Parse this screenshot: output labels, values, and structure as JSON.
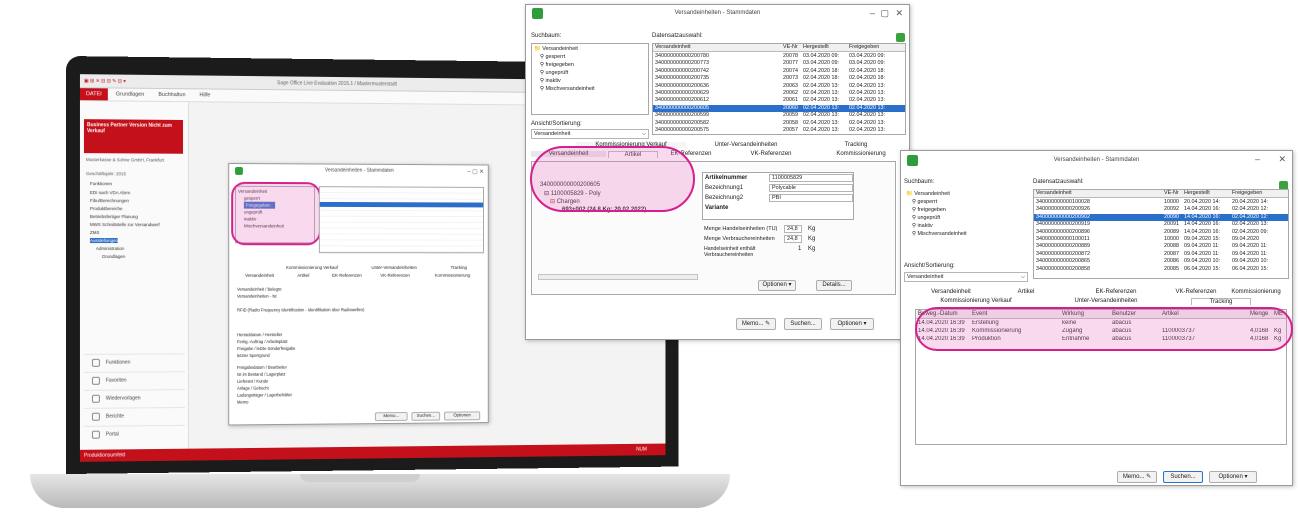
{
  "laptop": {
    "title": "Sage Office Line Evaluation 2015.1 / Mastermusterstadt",
    "menu": [
      "DATEI",
      "Grundlagen",
      "Buchhaltun",
      "Hilfe"
    ],
    "promo": "Business Partner Version Nicht zum Verkauf",
    "company": "Musterkasse & Sohne GmbH, Frankfurt",
    "fiscal": "Geschäftsjahr: 2015",
    "tree": [
      "Funktionen",
      "EDI nach VDA Abrm",
      "Fibu/Berechnungen",
      "Produktbereiche",
      "Betriebsfertiger Planung",
      "MWS Schnittstelle zur Versandwerf",
      "ZMS",
      "Ausstellungen",
      "Administration",
      "Grundlagen"
    ],
    "side_buttons": [
      "Funktionen",
      "Favoriten",
      "Wiedervorlagen",
      "Berichte",
      "Portal"
    ],
    "status_left": "Produktionsumfeld",
    "status_right": "NUM",
    "inner_title": "Versandeinheiten - Stammdaten",
    "inner_tree": [
      "Versandeinheit",
      "gesperrt",
      "Freigegeben",
      "ungeprüft",
      "inaktiv",
      "Mischversandeinheit"
    ],
    "inner_tabs_top": [
      "Kommissionierung Verkauf",
      "Unter-Versandeinheiten",
      "Tracking"
    ],
    "inner_tabs_bottom": [
      "Versandeinheit",
      "Artikel",
      "EK-Referenzen",
      "VK-Referenzen",
      "Kommissionierung"
    ],
    "inner_fields": [
      "Versandeinheit / Belegnr.",
      "Versandeinheiten - Nr.",
      "RFID (Radio Frequency Identification - Identifikation über Radiowellen)",
      "Hersteldatum / Hersteller",
      "Fertig.-Auftrag / Arbeitsplatz",
      "Freigabe / letzte Sonderfreigabe",
      "letzter Sperrgrund",
      "Freigabedatum / Bearbeiter",
      "Ist im Bestand / Lagerplatz",
      "Lieferant / Kunde",
      "Anlage / Gebucht",
      "Ladungsträger / Lagerbehälter",
      "Memo"
    ],
    "inner_buttons": [
      "Memo...",
      "Suchen...",
      "Optionen"
    ]
  },
  "win_top": {
    "title": "Versandeinheiten - Stammdaten",
    "suchbaum_label": "Suchbaum:",
    "datensatz_label": "Datensatzauswahl:",
    "tree": [
      "Versandeinheit",
      "gesperrt",
      "freigegeben",
      "ungeprüft",
      "inaktiv",
      "Mischversandeinheit"
    ],
    "columns": [
      "Versandeinheit",
      "VE-Nr",
      "Hergestellt",
      "Freigegeben"
    ],
    "rows": [
      [
        "340000000000200780",
        "20078",
        "03.04.2020 09:",
        "03.04.2020 09:"
      ],
      [
        "340000000000200773",
        "20077",
        "03.04.2020 09:",
        "03.04.2020 09:"
      ],
      [
        "340000000000200742",
        "20074",
        "02.04.2020 18:",
        "02.04.2020 18:"
      ],
      [
        "340000000000200735",
        "20073",
        "02.04.2020 18:",
        "02.04.2020 18:"
      ],
      [
        "340000000000200636",
        "20063",
        "02.04.2020 13:",
        "02.04.2020 13:"
      ],
      [
        "340000000000200629",
        "20062",
        "02.04.2020 13:",
        "02.04.2020 13:"
      ],
      [
        "340000000000200612",
        "20061",
        "02.04.2020 13:",
        "02.04.2020 13:"
      ],
      [
        "340000000000200605",
        "20060",
        "02.04.2020 13:",
        "02.04.2020 13:"
      ],
      [
        "340000000000200599",
        "20059",
        "02.04.2020 13:",
        "02.04.2020 13:"
      ],
      [
        "340000000000200582",
        "20058",
        "02.04.2020 13:",
        "02.04.2020 13:"
      ],
      [
        "340000000000200575",
        "20057",
        "02.04.2020 13:",
        "02.04.2020 13:"
      ]
    ],
    "selected_row": 7,
    "ansicht_label": "Ansicht/Sortierung:",
    "ansicht_value": "Versandeinheit",
    "tabs_top": [
      "Kommissionierung Verkauf",
      "Unter-Versandeinheiten",
      "Tracking"
    ],
    "tabs_bottom": [
      "Versandeinheit",
      "Artikel",
      "EK-Referenzen",
      "VK-Referenzen",
      "Kommissionierung"
    ],
    "detail_tree": [
      "340000000000200605",
      "1100005829 - Poly",
      "Chargen",
      "693+002 (24,8 Kg; 20.02.2022)"
    ],
    "fields": [
      [
        "Artikelnummer",
        "1100005829"
      ],
      [
        "Bezeichnung1",
        "Polycable"
      ],
      [
        "Bezeichnung2",
        "PBI"
      ],
      [
        "Variante",
        ""
      ]
    ],
    "menge": [
      [
        "Menge Handelseinheiten (TU)",
        "24,8",
        "Kg"
      ],
      [
        "Menge Verbrauchereinheiten",
        "24,8",
        "Kg"
      ],
      [
        "Handelseinheit enthält Verbrauchereinheiten",
        "1",
        "Kg"
      ]
    ],
    "buttons": [
      "Optionen",
      "Details...",
      "Memo...",
      "Suchen...",
      "Optionen"
    ]
  },
  "win_right": {
    "title": "Versandeinheiten - Stammdaten",
    "suchbaum_label": "Suchbaum:",
    "datensatz_label": "Datensatzauswahl:",
    "tree": [
      "Versandeinheit",
      "gesperrt",
      "freigegeben",
      "ungeprüft",
      "inaktiv",
      "Mischversandeinheit"
    ],
    "columns": [
      "Versandeinheit",
      "VE-Nr",
      "Hergestellt",
      "Freigegeben"
    ],
    "rows": [
      [
        "340000000000100028",
        "10000",
        "20.04.2020 14:",
        "20.04.2020 14:"
      ],
      [
        "340000000000200926",
        "20092",
        "14.04.2020 16:",
        "02.04.2020 12:"
      ],
      [
        "340000000000200902",
        "20090",
        "14.04.2020 16:",
        "02.04.2020 12:"
      ],
      [
        "340000000000200919",
        "20091",
        "14.04.2020 16:",
        "02.04.2020 13:"
      ],
      [
        "340000000000200896",
        "20089",
        "14.04.2020 16:",
        "02.04.2020 09:"
      ],
      [
        "340000000000100011",
        "10000",
        "09.04.2020 15:",
        "09.04.2020"
      ],
      [
        "340000000000200889",
        "20088",
        "09.04.2020 11:",
        "09.04.2020 11:"
      ],
      [
        "340000000000200872",
        "20087",
        "09.04.2020 11:",
        "09.04.2020 11:"
      ],
      [
        "340000000000200865",
        "20086",
        "09.04.2020 10:",
        "09.04.2020 10:"
      ],
      [
        "340000000000200858",
        "20085",
        "06.04.2020 15:",
        "06.04.2020 15:"
      ]
    ],
    "selected_row": 2,
    "ansicht_label": "Ansicht/Sortierung:",
    "ansicht_value": "Versandeinheit",
    "tabs_top": [
      "Versandeinheit",
      "Artikel",
      "EK-Referenzen",
      "VK-Referenzen",
      "Kommissionierung"
    ],
    "tabs_bottom": [
      "Kommissionierung Verkauf",
      "Unter-Versandeinheiten",
      "Tracking"
    ],
    "table_cols": [
      "Beweg.-Datum",
      "Event",
      "Wirkung",
      "Benutzer",
      "Artikel",
      "Menge",
      "ME"
    ],
    "table_rows": [
      [
        "14.04.2020 16:39",
        "Erstellung",
        "keine",
        "abacus",
        "",
        "",
        ""
      ],
      [
        "14.04.2020 16:39",
        "Kommissionierung",
        "Zugang",
        "abacus",
        "1100003737",
        "4,0168",
        "Kg"
      ],
      [
        "14.04.2020 16:39",
        "Produktion",
        "Entnahme",
        "abacus",
        "1100003737",
        "4,0168",
        "Kg"
      ]
    ],
    "buttons": [
      "Memo...",
      "Suchen...",
      "Optionen"
    ]
  },
  "colors": {
    "accent_red": "#c3101b",
    "highlight": "#d61f8e",
    "selection": "#2a6fca"
  }
}
